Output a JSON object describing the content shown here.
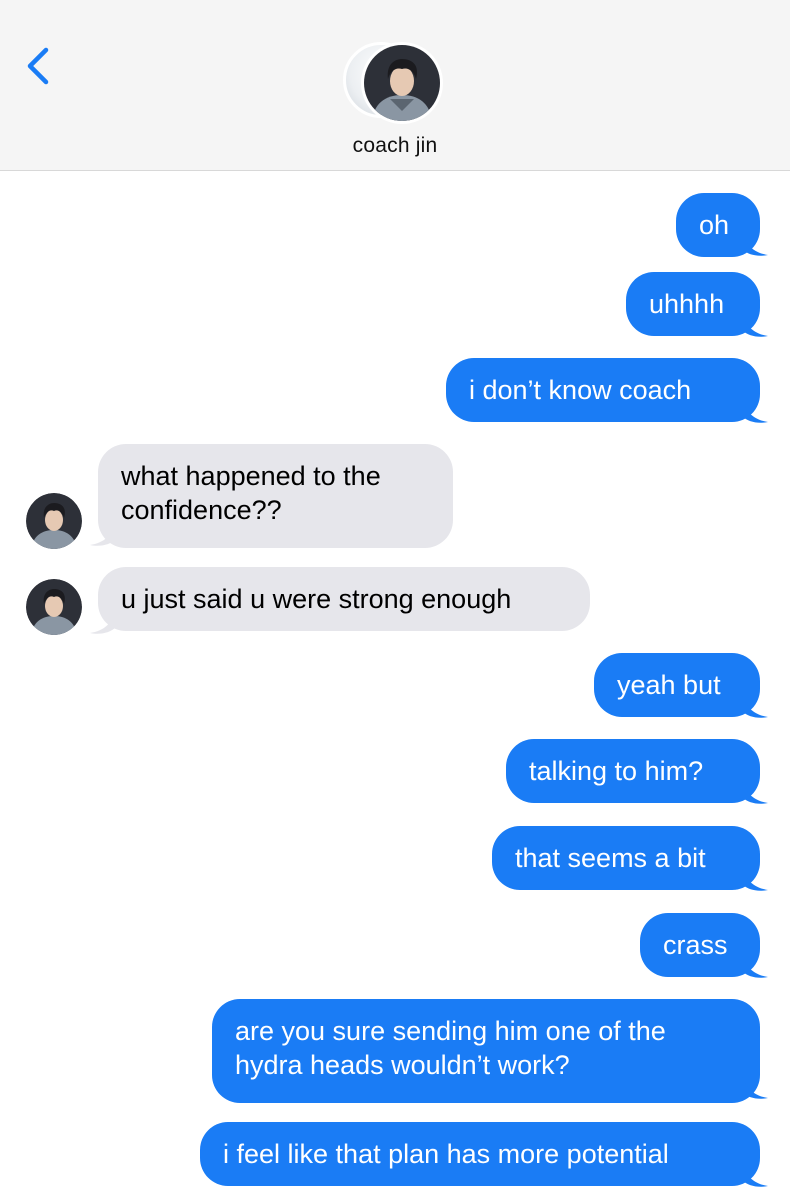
{
  "header": {
    "back_label": "",
    "contact_name": "coach jin"
  },
  "colors": {
    "outgoing_bubble": "#1a7cf5",
    "incoming_bubble": "#e6e6eb",
    "accent": "#1a7cf5"
  },
  "messages": [
    {
      "direction": "out",
      "text": "oh"
    },
    {
      "direction": "out",
      "text": "uhhhh"
    },
    {
      "direction": "out",
      "text": "i don’t know coach"
    },
    {
      "direction": "in",
      "lines": [
        "what happened to the",
        "confidence??"
      ]
    },
    {
      "direction": "in",
      "text": "u just said u were strong enough"
    },
    {
      "direction": "out",
      "text": "yeah but"
    },
    {
      "direction": "out",
      "text": "talking to him?"
    },
    {
      "direction": "out",
      "text": "that seems a bit"
    },
    {
      "direction": "out",
      "text": "crass"
    },
    {
      "direction": "out",
      "lines": [
        "are you sure sending him one of the",
        "hydra heads wouldn’t work?"
      ]
    },
    {
      "direction": "out",
      "text": "i feel like that plan has more potential"
    }
  ]
}
